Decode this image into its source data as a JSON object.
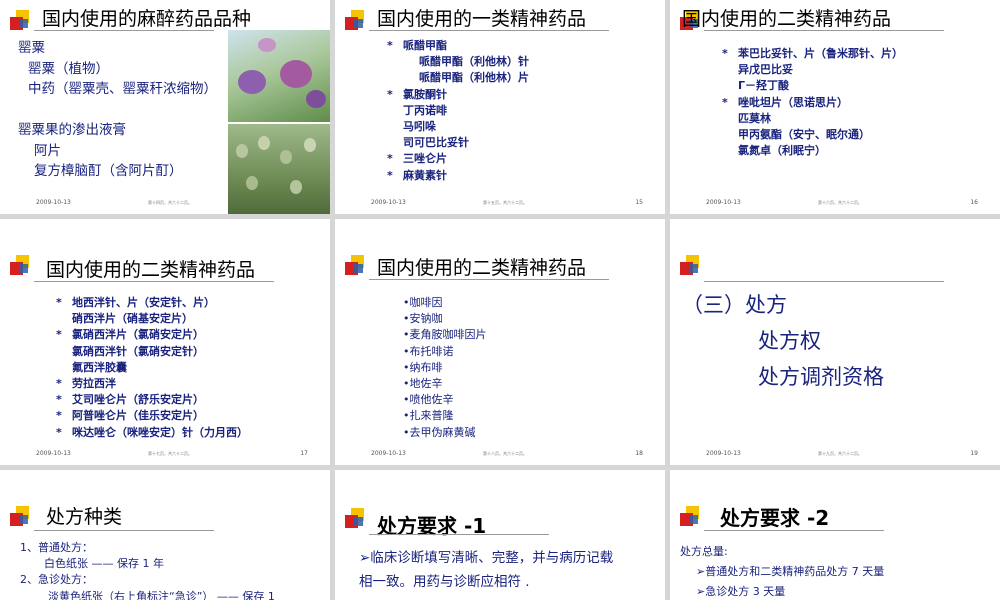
{
  "slides": [
    {
      "title": "国内使用的麻醉药品品种",
      "lines": [
        "罂粟",
        "罂粟（植物）",
        "中药（罂粟壳、罂粟秆浓缩物）",
        "",
        "罂粟果的渗出液膏",
        "阿片",
        "复方樟脑酊（含阿片酊）"
      ],
      "date": "2009-10-13",
      "mid": "第十四页，共六十二页。",
      "page": ""
    },
    {
      "title": "国内使用的一类精神药品",
      "lines": [
        "哌醋甲酯",
        "哌醋甲酯（利他林）针",
        "哌醋甲酯（利他林）片",
        "氯胺酮针",
        "丁丙诺啡",
        "马吲哚",
        "司可巴比妥针",
        "三唑仑片",
        "麻黄素针"
      ],
      "date": "2009-10-13",
      "mid": "第十五页，共六十二页。",
      "page": "15"
    },
    {
      "title": "国内使用的二类精神药品",
      "lines": [
        "苯巴比妥针、片（鲁米那针、片）",
        "异戊巴比妥",
        "Γ－羟丁酸",
        "唑吡坦片（思诺思片）",
        "匹莫林",
        "甲丙氨酯（安宁、眠尔通）",
        "氯氮卓（利眠宁）"
      ],
      "date": "2009-10-13",
      "mid": "第十六页，共六十二页。",
      "page": "16"
    },
    {
      "title": "国内使用的二类精神药品",
      "lines": [
        "地西泮针、片（安定针、片）",
        "硝西泮片（硝基安定片）",
        "氯硝西泮片（氯硝安定片）",
        "氯硝西泮针（氯硝安定针）",
        "氟西泮胶囊",
        "劳拉西泮",
        "艾司唑仑片（舒乐安定片）",
        "阿普唑仑片（佳乐安定片）",
        "咪达唑仑（咪唑安定）针（力月西）"
      ],
      "date": "2009-10-13",
      "mid": "第十七页，共六十二页。",
      "page": "17"
    },
    {
      "title": "国内使用的二类精神药品",
      "lines": [
        "•咖啡因",
        "•安钠咖",
        "•麦角胺咖啡因片",
        "•布托啡诺",
        "•纳布啡",
        "•地佐辛",
        "•喷他佐辛",
        "•扎来普隆",
        "•去甲伪麻黄碱"
      ],
      "date": "2009-10-13",
      "mid": "第十八页，共六十二页。",
      "page": "18"
    },
    {
      "title": "",
      "lines": [
        "（三）处方",
        "处方权",
        "处方调剂资格"
      ],
      "date": "2009-10-13",
      "mid": "第十九页，共六十二页。",
      "page": "19"
    },
    {
      "title": "处方种类",
      "lines": [
        "1、普通处方：",
        "白色纸张 —— 保存 1 年",
        "2、急诊处方：",
        "淡黄色纸张（右上角标注“急诊”） —— 保存 1"
      ]
    },
    {
      "title": "处方要求 -1",
      "lines": [
        "➢临床诊断填写清晰、完整，并与病历记载",
        "相一致。用药与诊断应相符 ."
      ]
    },
    {
      "title": "处方要求 -2",
      "lines": [
        "处方总量:",
        "➢普通处方和二类精神药品处方 7 天量",
        "➢急诊处方 3 天量"
      ]
    }
  ]
}
